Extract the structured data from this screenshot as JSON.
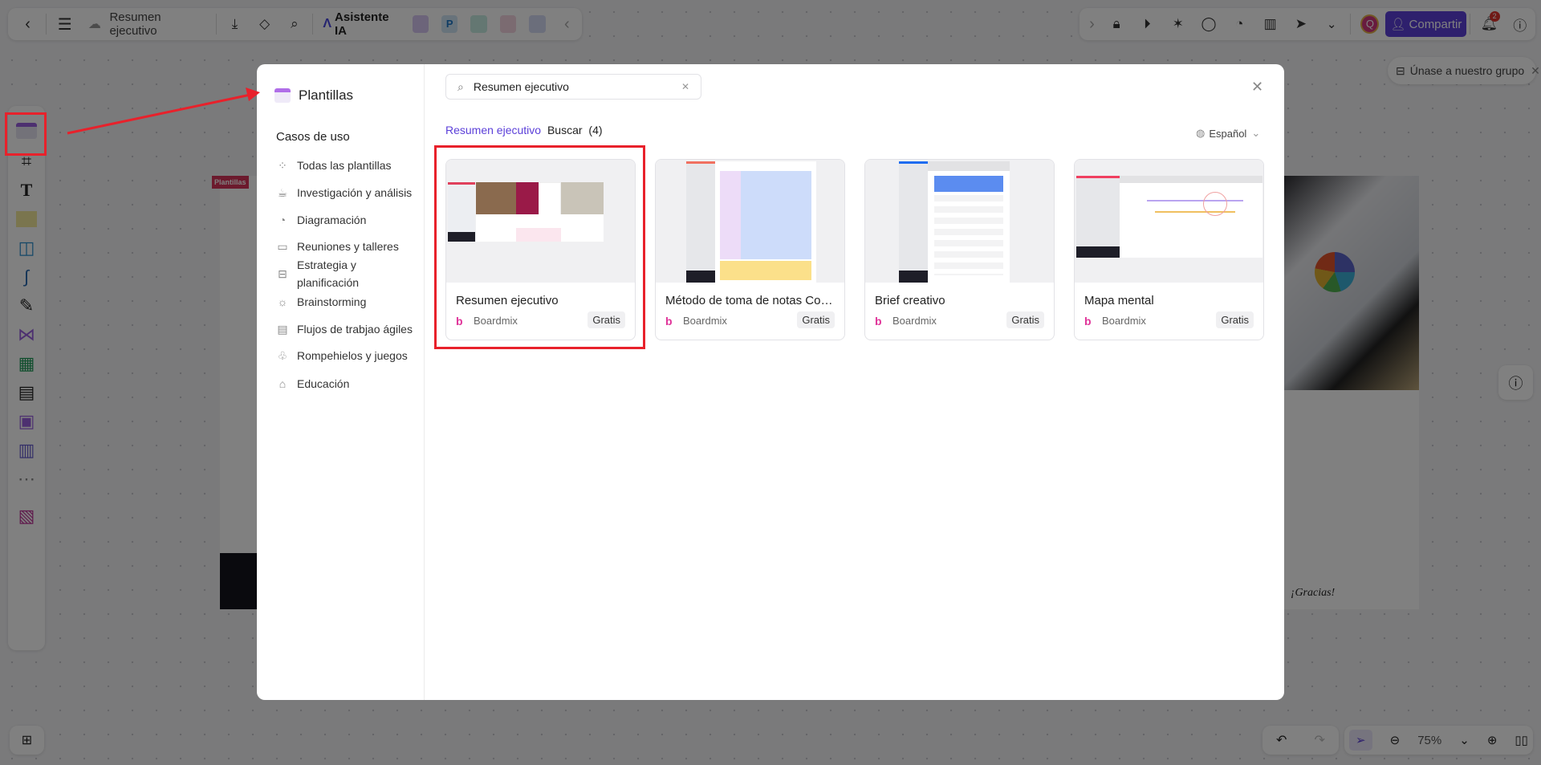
{
  "topbar": {
    "doc_title": "Resumen ejecutivo",
    "ai_label": "Asistente IA",
    "share_label": "Compartir",
    "avatar_letter": "Q",
    "notification_count": "2",
    "brand_color": "#5b3fd9"
  },
  "join_group": {
    "label": "Únase a nuestro grupo"
  },
  "canvas": {
    "tag": "Plantillas",
    "closing_text": "¡Gracias!"
  },
  "bottom": {
    "zoom": "75%"
  },
  "modal": {
    "title": "Plantillas",
    "section_title": "Casos de uso",
    "categories": [
      {
        "label": "Todas las plantillas",
        "icon": "grid-icon"
      },
      {
        "label": "Investigación y análisis",
        "icon": "coffee-icon"
      },
      {
        "label": "Diagramación",
        "icon": "pie-icon"
      },
      {
        "label": "Reuniones y talleres",
        "icon": "presentation-icon"
      },
      {
        "label": "Estrategia y planificación",
        "icon": "briefcase-icon"
      },
      {
        "label": "Brainstorming",
        "icon": "lightbulb-icon"
      },
      {
        "label": "Flujos de trabjao ágiles",
        "icon": "clipboard-icon"
      },
      {
        "label": "Rompehielos y juegos",
        "icon": "puzzle-icon"
      },
      {
        "label": "Educación",
        "icon": "graduation-cap-icon"
      }
    ],
    "search": {
      "value": "Resumen ejecutivo"
    },
    "results": {
      "query": "Resumen ejecutivo",
      "label": "Buscar",
      "count": "(4)"
    },
    "language": "Español",
    "templates": [
      {
        "title": "Resumen ejecutivo",
        "author": "Boardmix",
        "badge": "Gratis"
      },
      {
        "title": "Método de toma de notas Cornell",
        "author": "Boardmix",
        "badge": "Gratis"
      },
      {
        "title": "Brief creativo",
        "author": "Boardmix",
        "badge": "Gratis"
      },
      {
        "title": "Mapa mental",
        "author": "Boardmix",
        "badge": "Gratis"
      }
    ]
  },
  "annotation_color": "#e8212b"
}
